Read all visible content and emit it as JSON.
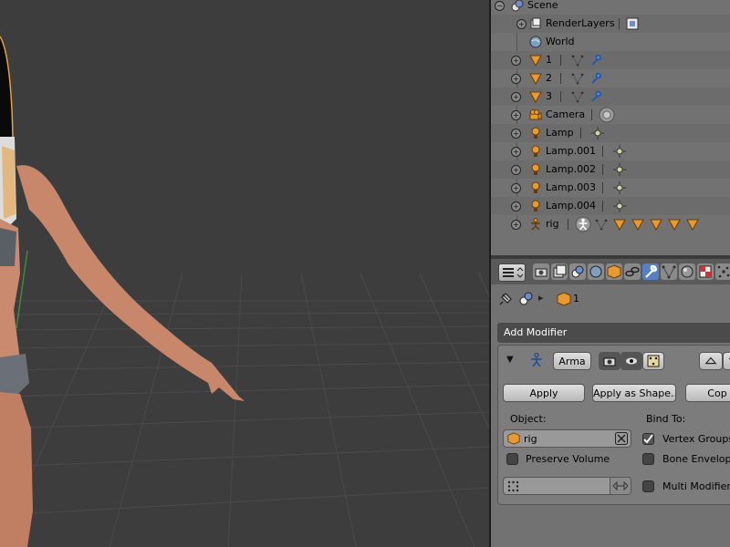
{
  "outliner": {
    "rows": [
      {
        "label": "Scene"
      },
      {
        "label": "RenderLayers"
      },
      {
        "label": "World"
      },
      {
        "label": "1"
      },
      {
        "label": "2"
      },
      {
        "label": "3"
      },
      {
        "label": "Camera"
      },
      {
        "label": "Lamp"
      },
      {
        "label": "Lamp.001"
      },
      {
        "label": "Lamp.002"
      },
      {
        "label": "Lamp.003"
      },
      {
        "label": "Lamp.004"
      },
      {
        "label": "rig"
      }
    ]
  },
  "properties": {
    "breadcrumb_object": "1",
    "add_modifier_label": "Add Modifier",
    "modifier": {
      "name": "Arma",
      "apply_label": "Apply",
      "apply_shape_label": "Apply as Shape...",
      "copy_label": "Cop",
      "object_label": "Object:",
      "object_value": "rig",
      "bind_to_label": "Bind To:",
      "vertex_groups_label": "Vertex Groups",
      "vertex_groups_checked": true,
      "preserve_volume_label": "Preserve Volume",
      "preserve_volume_checked": false,
      "bone_envelopes_label": "Bone Envelope",
      "bone_envelopes_checked": false,
      "multi_modifier_label": "Multi Modifier",
      "multi_modifier_checked": false
    }
  },
  "colors": {
    "viewport_bg": "#3d3d3d",
    "outliner_bg": "#727272",
    "panel_bg": "#7c7c7c",
    "active_tab": "#5680c2",
    "mesh_orange": "#e89a32"
  }
}
